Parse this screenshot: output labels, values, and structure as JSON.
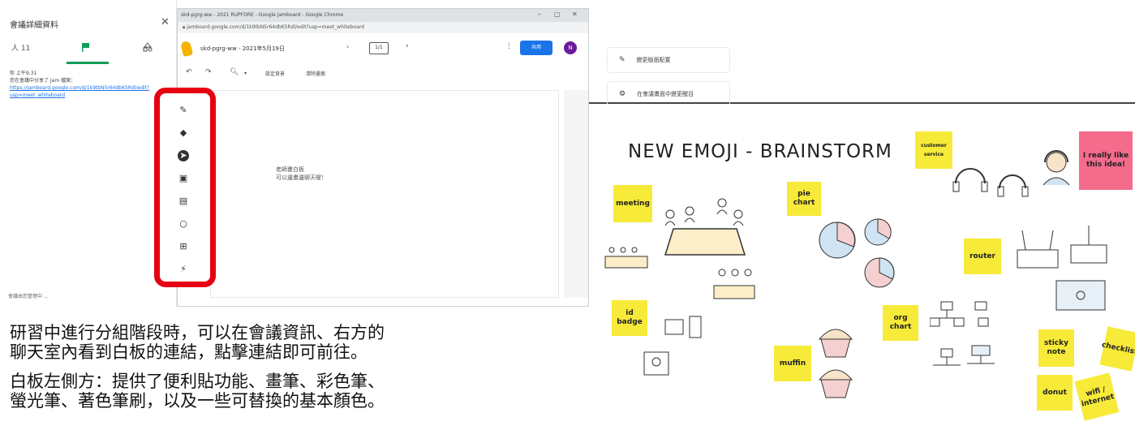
{
  "meeting_panel": {
    "title": "會議詳細資料",
    "tab_people_count": "人 11",
    "msg_author": "你 上午9:31",
    "msg_text": "您在會議中分享了 Jam 檔案：",
    "msg_link": "https://jamboard.google.com/d/1k9tbN5r64dbK5Rdl/edit?usp=meet_whiteboard",
    "footer": "會議由您管理中 ..."
  },
  "browser": {
    "title": "skd-pgrg-ww - 2021 RUPFORE - Google Jamboard - Google Chrome",
    "url": "jamboard.google.com/d/1k9tbN5r64dbK5Rdl/edit?usp=meet_whiteboard"
  },
  "jamboard": {
    "doc_title": "skd-pgrg-ww - 2021年5月19日",
    "frame_counter": "1/1",
    "share_label": "共用",
    "avatar_letter": "N",
    "set_background": "設定背景",
    "clear_frame": "清除畫面",
    "canvas_note_line1": "老師畫白板",
    "canvas_note_line2": "可以邊畫邊聊天喔！"
  },
  "right_panel": {
    "item1": "變更版面配置",
    "item2": "在會議畫面中變更醒目"
  },
  "whiteboard": {
    "title": "NEW EMOJI - BRAINSTORM",
    "stickies": {
      "meeting": "meeting",
      "pie_chart": "pie chart",
      "customer_service": "customer service",
      "i_really": "I really like this idea!",
      "router": "router",
      "id_badge": "id badge",
      "org_chart": "org chart",
      "muffin": "muffin",
      "sticky_note": "sticky note",
      "checklist": "checklist",
      "donut": "donut",
      "wifi": "wifi / internet"
    }
  },
  "caption": {
    "line1": "研習中進行分組階段時，可以在會議資訊、右方的",
    "line2": "聊天室內看到白板的連結，點擊連結即可前往。",
    "line3": "白板左側方：提供了便利貼功能、畫筆、彩色筆、",
    "line4": "螢光筆、著色筆刷，以及一些可替換的基本顏色。"
  },
  "colors": {
    "highlight": "#e60012",
    "sticky_yellow": "#f7ea38",
    "sticky_pink": "#f46b8c",
    "accent": "#1a73e8"
  }
}
